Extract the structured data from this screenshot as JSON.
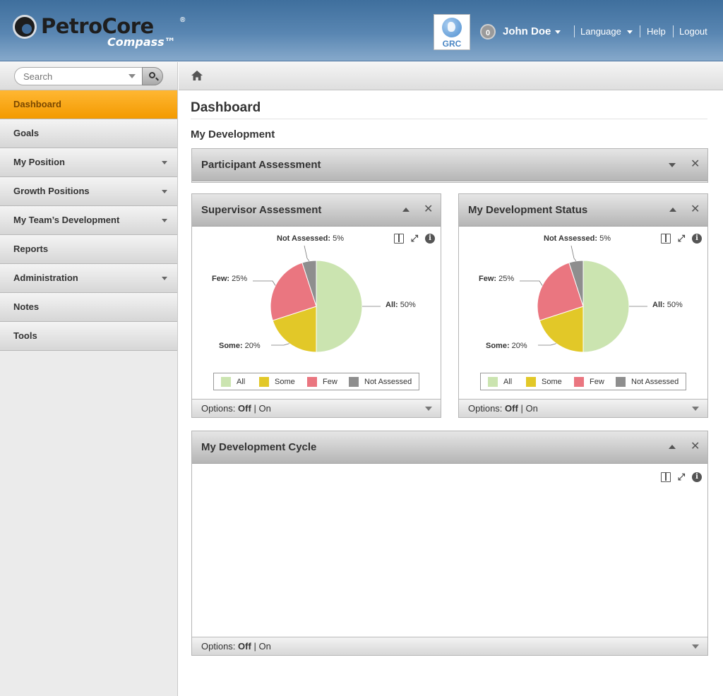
{
  "header": {
    "logo_name": "PetroCore",
    "logo_reg": "®",
    "logo_sub": "Compass™",
    "grc_label": "GRC",
    "notification_count": "0",
    "user_name": "John Doe",
    "nav": {
      "language": "Language",
      "help": "Help",
      "logout": "Logout"
    }
  },
  "sidebar": {
    "search_placeholder": "Search",
    "items": [
      {
        "label": "Dashboard",
        "active": true,
        "has_submenu": false
      },
      {
        "label": "Goals",
        "has_submenu": false
      },
      {
        "label": "My Position",
        "has_submenu": true
      },
      {
        "label": "Growth Positions",
        "has_submenu": true
      },
      {
        "label": "My Team’s Development",
        "has_submenu": true
      },
      {
        "label": "Reports",
        "has_submenu": false
      },
      {
        "label": "Administration",
        "has_submenu": true
      },
      {
        "label": "Notes",
        "has_submenu": false
      },
      {
        "label": "Tools",
        "has_submenu": false
      }
    ]
  },
  "main": {
    "page_title": "Dashboard",
    "section_title": "My Development",
    "panels": {
      "participant": {
        "title": "Participant Assessment"
      },
      "supervisor": {
        "title": "Supervisor Assessment"
      },
      "status": {
        "title": "My Development Status"
      },
      "cycle": {
        "title": "My Development Cycle"
      }
    },
    "options": {
      "label": "Options:",
      "off": "Off",
      "sep": "|",
      "on": "On"
    }
  },
  "colors": {
    "all": "#cbe4b0",
    "some": "#e2c828",
    "few": "#ea7680",
    "not_assessed": "#8e8e8e",
    "active_nav": "#f39a00"
  },
  "chart_data": [
    {
      "type": "pie",
      "categories": [
        "All",
        "Some",
        "Few",
        "Not Assessed"
      ],
      "values": [
        50,
        20,
        25,
        5
      ],
      "data_labels": [
        "All: 50%",
        "Some: 20%",
        "Few: 25%",
        "Not Assessed: 5%"
      ],
      "legend": [
        "All",
        "Some",
        "Few",
        "Not Assessed"
      ],
      "legend_position": "bottom"
    },
    {
      "type": "pie",
      "categories": [
        "All",
        "Some",
        "Few",
        "Not Assessed"
      ],
      "values": [
        50,
        20,
        25,
        5
      ],
      "data_labels": [
        "All: 50%",
        "Some: 20%",
        "Few: 25%",
        "Not Assessed: 5%"
      ],
      "legend": [
        "All",
        "Some",
        "Few",
        "Not Assessed"
      ],
      "legend_position": "bottom"
    }
  ]
}
